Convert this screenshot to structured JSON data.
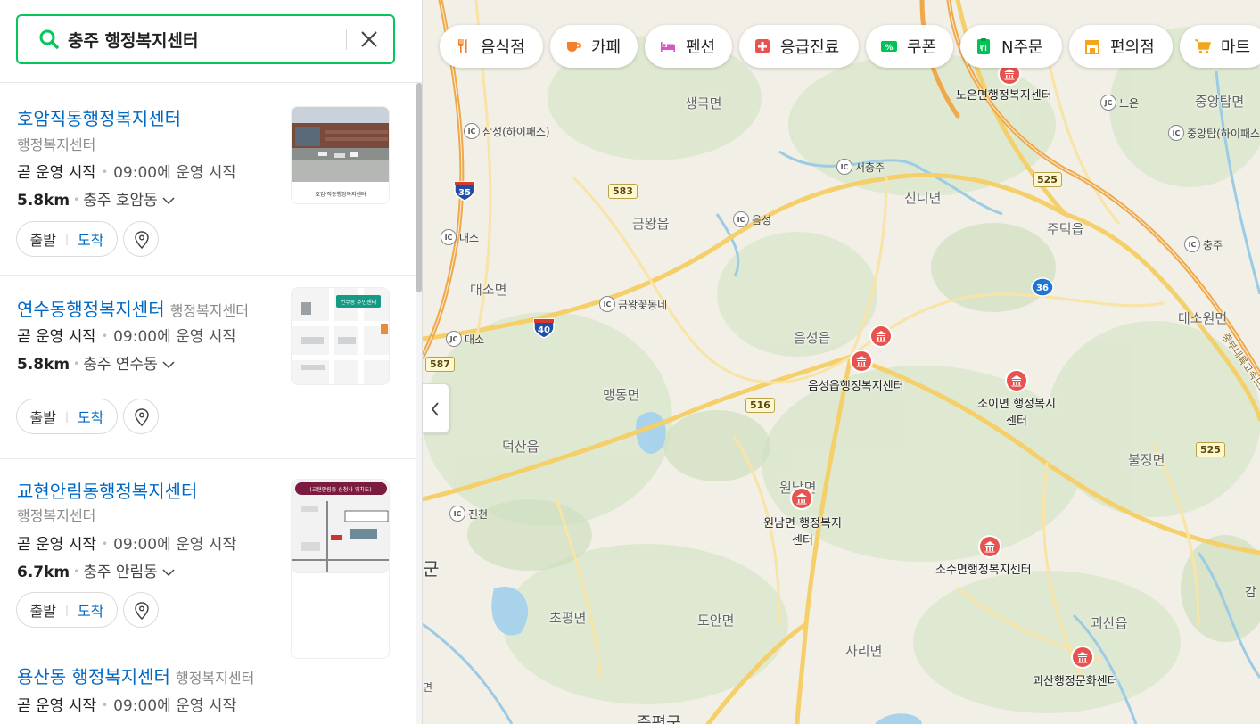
{
  "search": {
    "query": "충주 행정복지센터"
  },
  "results": [
    {
      "title": "호암직동행정복지센터",
      "category": "행정복지센터",
      "status": "곧 운영 시작",
      "hours": "09:00에 운영 시작",
      "distance": "5.8km",
      "area": "충주 호암동",
      "btn_start": "출발",
      "btn_arrive": "도착",
      "thumb_caption": "호암·직동행정복지센터"
    },
    {
      "title": "연수동행정복지센터",
      "category": "행정복지센터",
      "status": "곧 운영 시작",
      "hours": "09:00에 운영 시작",
      "distance": "5.8km",
      "area": "충주 연수동",
      "btn_start": "출발",
      "btn_arrive": "도착",
      "thumb_caption": "연수동 주민센터"
    },
    {
      "title": "교현안림동행정복지센터",
      "category": "행정복지센터",
      "status": "곧 운영 시작",
      "hours": "09:00에 운영 시작",
      "distance": "6.7km",
      "area": "충주 안림동",
      "btn_start": "출발",
      "btn_arrive": "도착",
      "thumb_caption": "(교현안림동 신청사 위치도)"
    },
    {
      "title": "용산동 행정복지센터",
      "category": "행정복지센터",
      "status": "곧 운영 시작",
      "hours": "09:00에 운영 시작"
    }
  ],
  "chips": [
    {
      "label": "음식점",
      "icon": "fork-knife-icon",
      "color": "#f27f2a"
    },
    {
      "label": "카페",
      "icon": "coffee-cup-icon",
      "color": "#f27f2a"
    },
    {
      "label": "펜션",
      "icon": "bed-icon",
      "color": "#d655c7"
    },
    {
      "label": "응급진료",
      "icon": "medical-cross-icon",
      "color": "#e8524f"
    },
    {
      "label": "쿠폰",
      "icon": "coupon-icon",
      "color": "#00c356"
    },
    {
      "label": "N주문",
      "icon": "order-icon",
      "color": "#00c356"
    },
    {
      "label": "편의점",
      "icon": "store-icon",
      "color": "#f3a51c"
    },
    {
      "label": "마트",
      "icon": "cart-icon",
      "color": "#f3a51c"
    }
  ],
  "map": {
    "regions": [
      "생극면",
      "금왕읍",
      "대소면",
      "맹동면",
      "덕산읍",
      "음성읍",
      "신니면",
      "주덕읍",
      "대소원면",
      "불정면",
      "원남면",
      "초평면",
      "도안면",
      "사리면",
      "괴산읍",
      "중앙탑면",
      "노은",
      "금왕꽃동네",
      "진천",
      "중부내륙고속도로",
      "군",
      "증평군",
      "면",
      "감"
    ],
    "ics": [
      "삼성(하이패스)",
      "대소",
      "음성",
      "서충주",
      "금왕꽃동네",
      "대소",
      "진천",
      "충주",
      "노은",
      "중앙탑(하이패스)"
    ],
    "road_numbers": [
      "583",
      "587",
      "516",
      "525",
      "525"
    ],
    "highways": [
      "35",
      "40",
      "36"
    ],
    "centers": [
      "노은면행정복지센터",
      "음성읍행정복지센터",
      "소이면 행정복지센터",
      "원남면 행정복지센터",
      "소수면행정복지센터",
      "괴산행정문화센터"
    ]
  },
  "colors": {
    "accent": "#03c75a",
    "link": "#0068c3",
    "pin": "#e8524f"
  }
}
